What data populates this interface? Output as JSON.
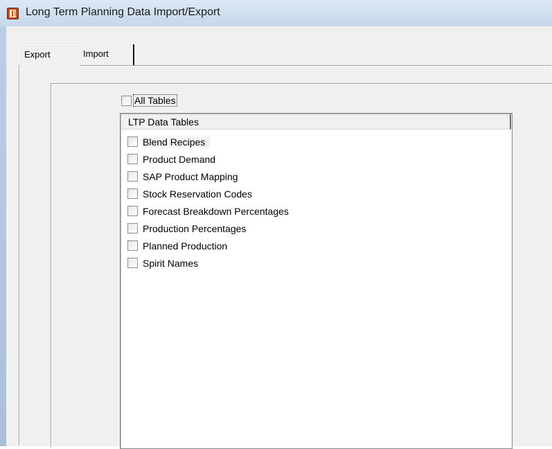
{
  "window": {
    "title": "Long Term Planning Data Import/Export"
  },
  "tabs": [
    {
      "label": "Export",
      "active": true
    },
    {
      "label": "Import",
      "active": false
    }
  ],
  "all_tables": {
    "label": "All Tables",
    "checked": false
  },
  "listview": {
    "header": "LTP Data Tables",
    "items": [
      {
        "label": "Blend Recipes",
        "checked": false
      },
      {
        "label": "Product Demand",
        "checked": false
      },
      {
        "label": "SAP Product Mapping",
        "checked": false
      },
      {
        "label": "Stock Reservation Codes",
        "checked": false
      },
      {
        "label": "Forecast Breakdown Percentages",
        "checked": false
      },
      {
        "label": "Production Percentages",
        "checked": false
      },
      {
        "label": "Planned Production",
        "checked": false
      },
      {
        "label": "Spirit Names",
        "checked": false
      }
    ]
  }
}
